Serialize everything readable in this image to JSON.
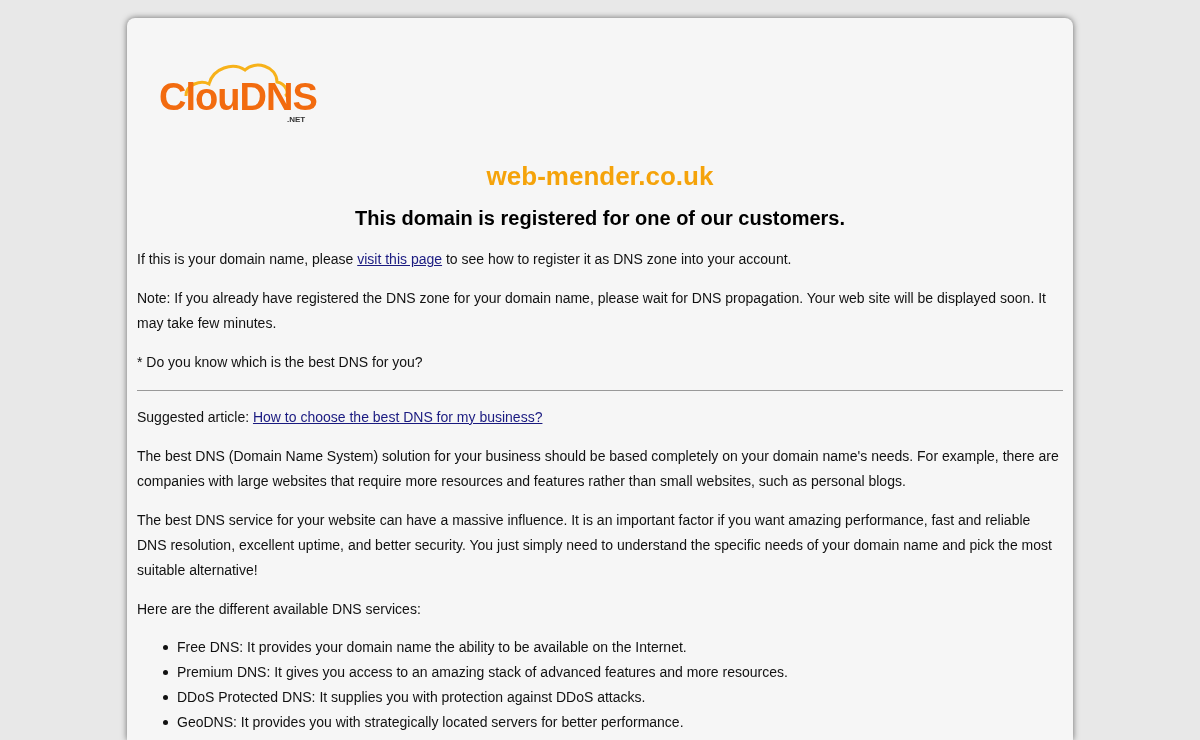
{
  "logo": {
    "name": "ClouDNS",
    "suffix": ".NET"
  },
  "domain": "web-mender.co.uk",
  "headline": "This domain is registered for one of our customers.",
  "intro": [
    {
      "before": "If this is your domain name, please ",
      "link": "visit this page",
      "after": " to see how to register it as DNS zone into your account."
    },
    {
      "before": "Note: If you already have registered the DNS zone for your domain name, please wait for DNS propagation. Your web site will be displayed soon. It may take few minutes."
    },
    {
      "before": "* Do you know which is the best DNS for you?"
    }
  ],
  "article": [
    {
      "before": "Suggested article: ",
      "link": "How to choose the best DNS for my business?"
    },
    {
      "before": "The best DNS (Domain Name System) solution for your business should be based completely on your domain name's needs. For example, there are companies with large websites that require more resources and features rather than small websites, such as personal blogs."
    },
    {
      "before": "The best DNS service for your website can have a massive influence. It is an important factor if you want amazing performance, fast and reliable DNS resolution, excellent uptime, and better security. You just simply need to understand the specific needs of your domain name and pick the most suitable alternative!"
    },
    {
      "before": "Here are the different available DNS services:"
    }
  ],
  "services": [
    "Free DNS: It provides your domain name the ability to be available on the Internet.",
    "Premium DNS: It gives you access to an amazing stack of advanced features and more resources.",
    "DDoS Protected DNS: It supplies you with protection against DDoS attacks.",
    "GeoDNS: It provides you with strategically located servers for better performance."
  ]
}
